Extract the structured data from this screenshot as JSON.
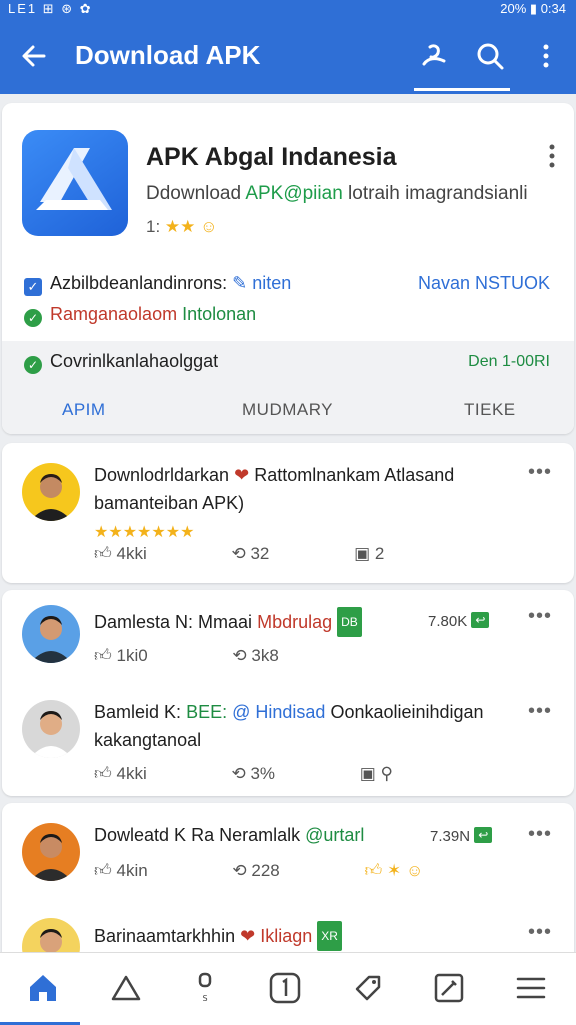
{
  "status": {
    "left": "LE1 ⊞ ⊛ ✿",
    "right": "20% ▮ 0:34"
  },
  "appbar": {
    "title": "Download APK"
  },
  "hero": {
    "app_name": "APK Abgal Indanesia",
    "subtitle_a": "Ddownload",
    "subtitle_b": "APK@piian",
    "subtitle_c": "lotraih imagrandsianli",
    "rating_num": "1:",
    "stars": "★★",
    "permissions_label": "Azbilbdeanlandinrons:",
    "permissions_link": "niten",
    "permissions_action": "Navan NSTUOK",
    "check2_a": "Ramganaolaom",
    "check2_b": "Intolonan",
    "status_text": "Covrinlkanlahaolggat",
    "status_value": "Den 1-00RI",
    "tabs": [
      "APIM",
      "MUDMARY",
      "TIEKE"
    ]
  },
  "posts": [
    {
      "line1_a": "Downlodrldarkan",
      "line1_b": "Rattomlnankam Atlasand",
      "line2": "bamanteiban APK)",
      "stars": "★★★★★★★",
      "likes": "4kki",
      "reposts": "32",
      "shares": "2"
    },
    {
      "name": "Damlesta N:",
      "line_a": "Mmaai",
      "line_b": "Mbdrulag",
      "tag": "DB",
      "count": "7.80K",
      "likes": "1ki0",
      "reposts": "3k8"
    },
    {
      "name": "Bamleid K:",
      "line_a": "BEE:",
      "line_b": "@ Hindisad",
      "line_c": "Oonkaolieinihdigan",
      "line2": "kakangtanoal",
      "likes": "4kki",
      "reposts": "3%"
    },
    {
      "line_a": "Dowleatd K",
      "line_b": "Ra Neramlalk",
      "line_c": "@urtarl",
      "count": "7.39N",
      "likes": "4kin",
      "reposts": "228"
    },
    {
      "line_a": "Barinaamtarkhhin",
      "line_b": "Ikliagn",
      "tag": "XR"
    }
  ],
  "colors": {
    "primary": "#2f6fd6",
    "green": "#2e9e47",
    "star": "#f3b21b"
  }
}
